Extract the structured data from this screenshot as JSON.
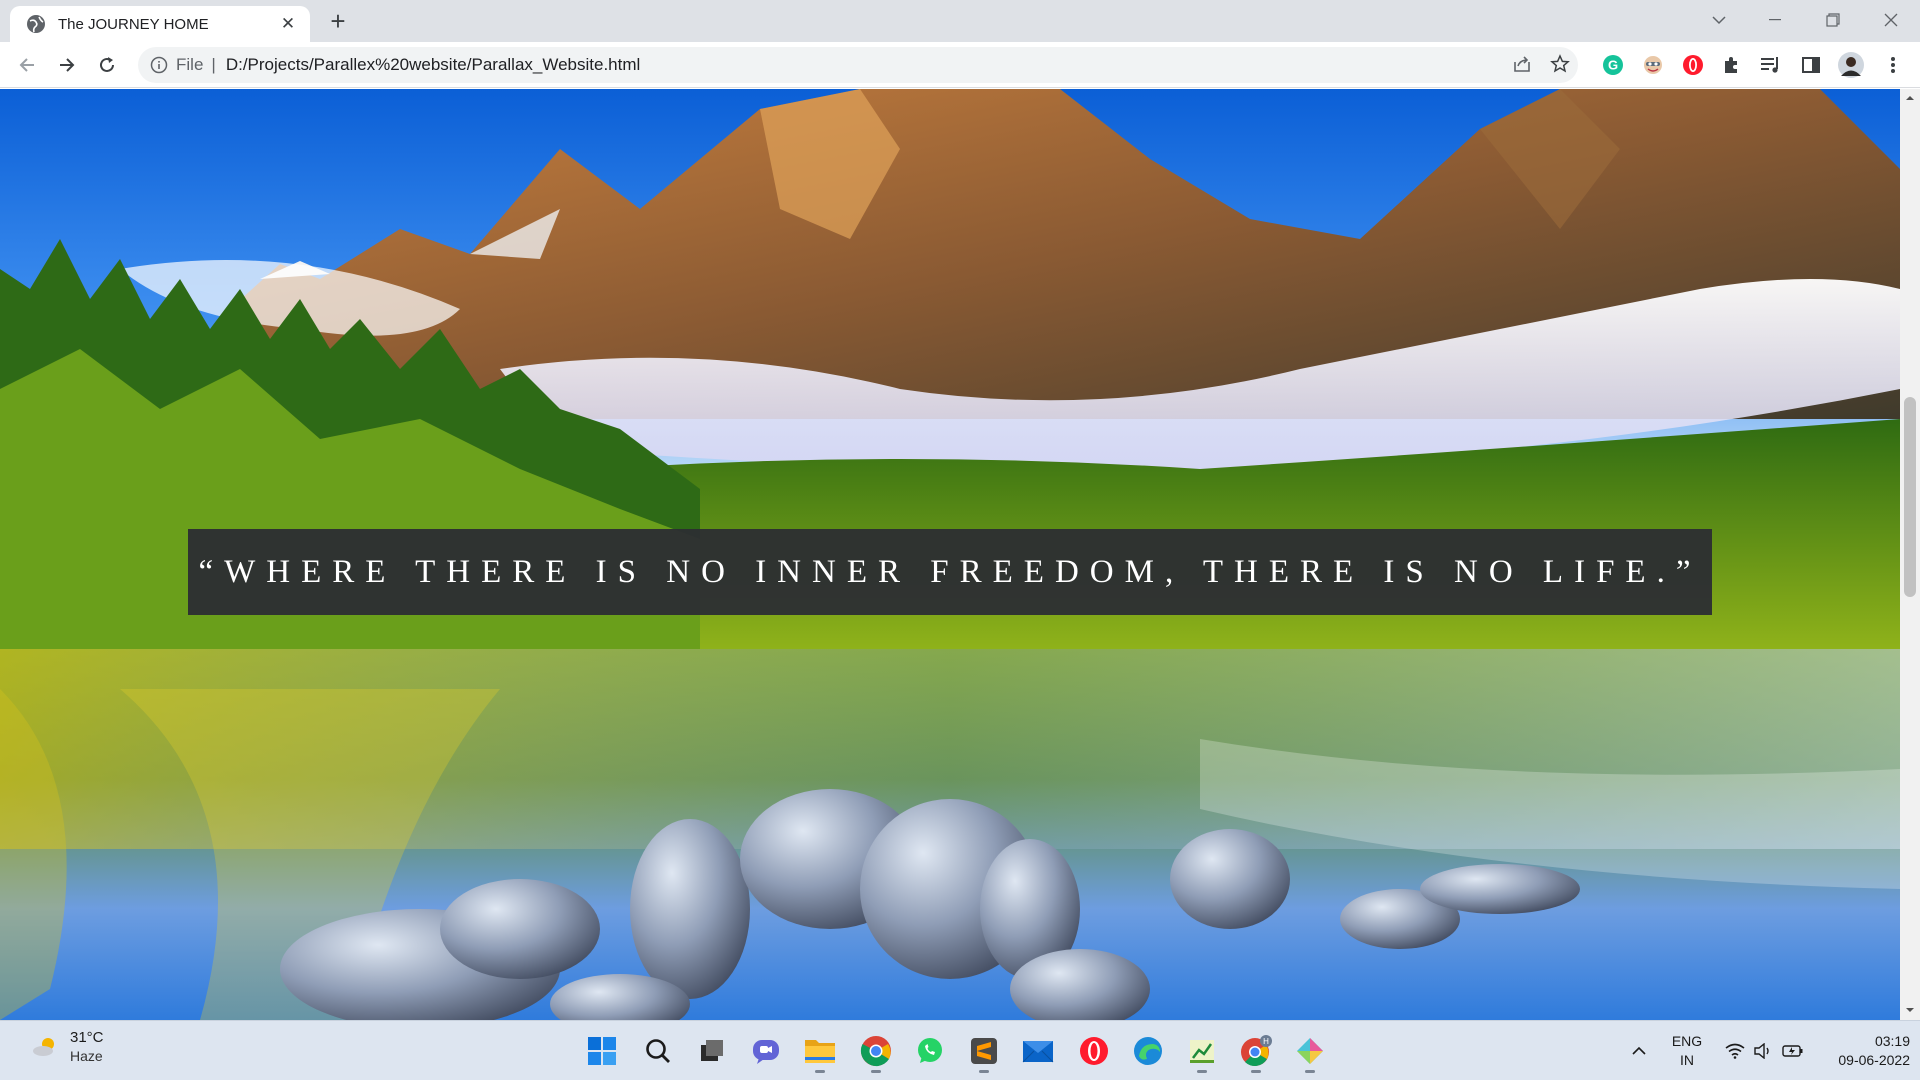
{
  "browser": {
    "tab_title": "The JOURNEY HOME",
    "url_scheme": "File",
    "url": "D:/Projects/Parallex%20website/Parallax_Website.html",
    "icons": [
      "back-icon",
      "forward-icon",
      "reload-icon",
      "info-icon",
      "share-icon",
      "star-icon",
      "grammarly-icon",
      "extension-avatar-icon",
      "opera-extension-icon",
      "puzzle-icon",
      "reading-list-icon",
      "sidepanel-icon",
      "profile-avatar-icon",
      "menu-dots-icon"
    ]
  },
  "page": {
    "quote": "“WHERE THERE IS NO INNER FREEDOM, THERE IS NO LIFE.”"
  },
  "taskbar": {
    "weather_temp": "31°C",
    "weather_desc": "Haze",
    "apps": [
      "windows-start",
      "search",
      "task-view",
      "teams-chat",
      "file-explorer",
      "chrome",
      "whatsapp",
      "sublime-text",
      "mail",
      "opera",
      "edge",
      "spreadsheet-app",
      "chrome-profile",
      "git-app"
    ],
    "lang_top": "ENG",
    "lang_bottom": "IN",
    "time": "03:19",
    "date": "09-06-2022"
  },
  "colors": {
    "quote_bg": "#2d2f32",
    "tabstrip": "#dee1e6",
    "taskbar": "#dde5f0"
  }
}
